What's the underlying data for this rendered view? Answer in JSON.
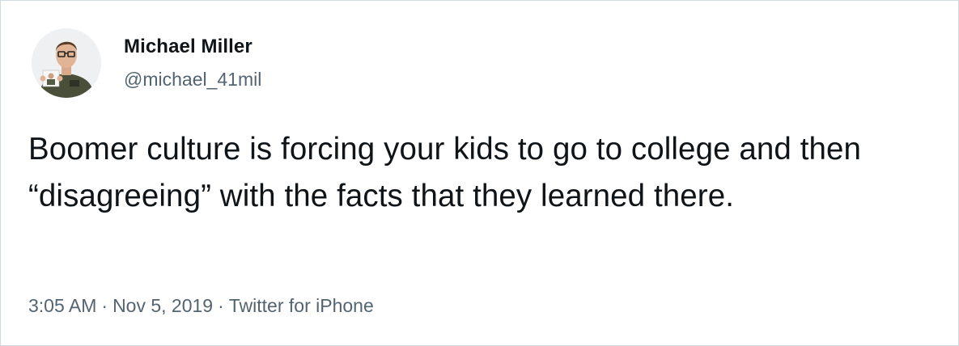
{
  "tweet": {
    "author": {
      "display_name": "Michael Miller",
      "handle": "@michael_41mil",
      "avatar_icon": "profile-photo"
    },
    "text": "Boomer culture is forcing your kids to go to college and then “disagreeing” with the facts that they learned there.",
    "time": "3:05 AM",
    "date": "Nov 5, 2019",
    "source": "Twitter for iPhone",
    "separator": "·"
  },
  "colors": {
    "text_primary": "#0f1419",
    "text_secondary": "#536471",
    "border": "#cfd9de",
    "background": "#ffffff"
  }
}
